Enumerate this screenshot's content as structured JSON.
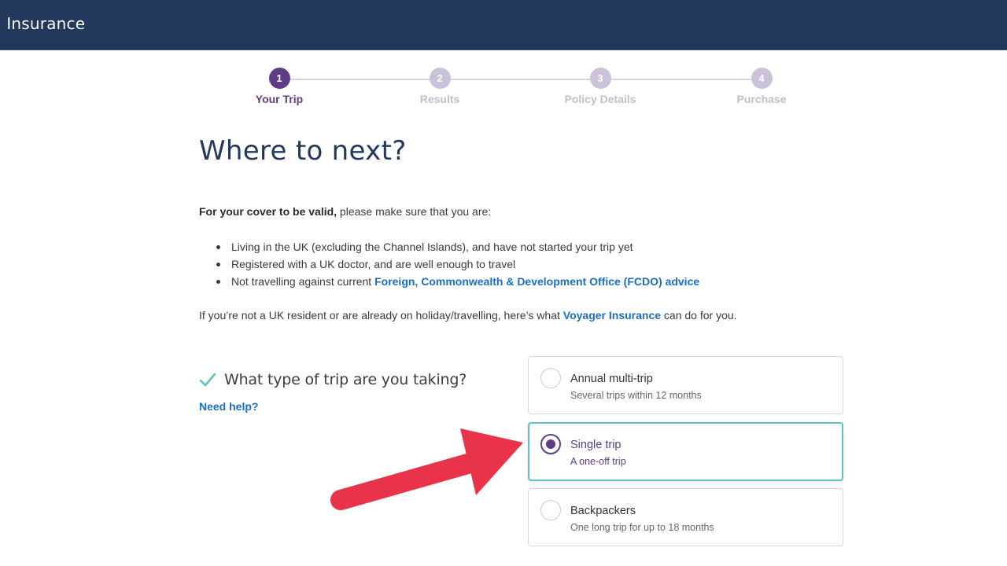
{
  "header": {
    "brand": "l Insurance",
    "background_color": "#22395d"
  },
  "stepper": {
    "current_step": 1,
    "steps": [
      {
        "number": "1",
        "label": "Your Trip",
        "state": "active"
      },
      {
        "number": "2",
        "label": "Results",
        "state": "inactive"
      },
      {
        "number": "3",
        "label": "Policy Details",
        "state": "inactive"
      },
      {
        "number": "4",
        "label": "Purchase",
        "state": "inactive"
      }
    ],
    "active_color": "#5f3d86",
    "inactive_color": "#cbc2d9"
  },
  "page": {
    "title": "Where to next?",
    "intro_bold": "For your cover to be valid,",
    "intro_rest": " please make sure that you are:",
    "requirements": [
      {
        "text": "Living in the UK (excluding the Channel Islands), and have not started your trip yet",
        "link": null
      },
      {
        "text": "Registered with a UK doctor, and are well enough to travel",
        "link": null
      },
      {
        "text": "Not travelling against current ",
        "link": "Foreign, Commonwealth & Development Office (FCDO) advice"
      }
    ],
    "non_resident": {
      "before": "If you’re not a UK resident or are already on holiday/travelling, here’s what ",
      "link": "Voyager Insurance",
      "after": " can do for you."
    }
  },
  "trip_question": {
    "question": "What type of trip are you taking?",
    "help_link": "Need help?",
    "answered": true,
    "check_color": "#5cc2c2",
    "options": [
      {
        "title": "Annual multi-trip",
        "subtitle": "Several trips within 12 months",
        "selected": false
      },
      {
        "title": "Single trip",
        "subtitle": "A one-off trip",
        "selected": true
      },
      {
        "title": "Backpackers",
        "subtitle": "One long trip for up to 18 months",
        "selected": false
      }
    ]
  },
  "annotation": {
    "type": "arrow",
    "points_to": "Single trip",
    "color": "#e8334a"
  },
  "colors": {
    "link": "#1a6fc4",
    "title": "#22395d",
    "selected_border": "#5cc2c2"
  }
}
